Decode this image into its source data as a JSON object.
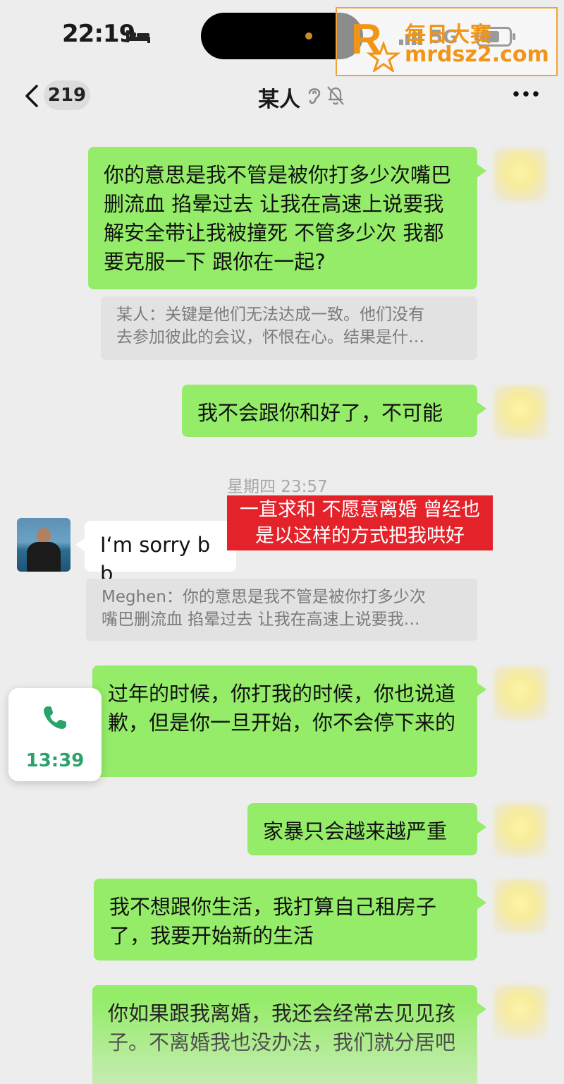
{
  "status_bar": {
    "time": "22:19",
    "network": "5G",
    "icons": [
      "bed-icon",
      "signal-icon",
      "battery-icon"
    ]
  },
  "watermark": {
    "title": "每日大赛",
    "url": "mrdsz2.com",
    "logo_text": "每日大赛",
    "color": "#f19516"
  },
  "nav": {
    "back_icon": "chevron-left-icon",
    "unread_count": "219",
    "title": "某人",
    "icons": [
      "ear-icon",
      "mute-bell-icon",
      "more-icon"
    ]
  },
  "messages": [
    {
      "id": "m1",
      "side": "out",
      "text": "你的意思是我不管是被你打多少次嘴巴删流血 掐晕过去 让我在高速上说要我解安全带让我被撞死 不管多少次 我都要克服一下 跟你在一起?"
    },
    {
      "id": "q1",
      "side": "quote",
      "lines": [
        "某人：关键是他们无法达成一致。他们没有",
        "去参加彼此的会议，怀恨在心。结果是什…"
      ]
    },
    {
      "id": "m2",
      "side": "out",
      "text": "我不会跟你和好了，不可能"
    },
    {
      "id": "m3",
      "side": "in",
      "text": "I‘m sorry bb"
    },
    {
      "id": "q2",
      "side": "quote",
      "lines": [
        "Meghen：你的意思是我不管是被你打多少次",
        "嘴巴删流血 掐晕过去 让我在高速上说要我…"
      ]
    },
    {
      "id": "m4",
      "side": "out",
      "text": "过年的时候，你打我的时候，你也说道歉，但是你一旦开始，你不会停下来的"
    },
    {
      "id": "m5",
      "side": "out",
      "text": "家暴只会越来越严重"
    },
    {
      "id": "m6",
      "side": "out",
      "text": "我不想跟你生活，我打算自己租房子了，我要开始新的生活"
    },
    {
      "id": "m7",
      "side": "out",
      "text": "你如果跟我离婚，我还会经常去见见孩子。不离婚我也没办法，我们就分居吧"
    }
  ],
  "timestamp": "星期四 23:57",
  "caption_overlay": {
    "lines": [
      "一直求和 不愿意离婚 曾经也",
      "是以这样的方式把我哄好"
    ],
    "color": "#e4222a"
  },
  "call_card": {
    "icon": "phone-icon",
    "duration": "13:39",
    "color": "#2aa36b"
  },
  "colors": {
    "background": "#ededed",
    "outgoing_bubble": "#95ec69",
    "incoming_bubble": "#ffffff",
    "quote_background": "#e2e2e2"
  }
}
